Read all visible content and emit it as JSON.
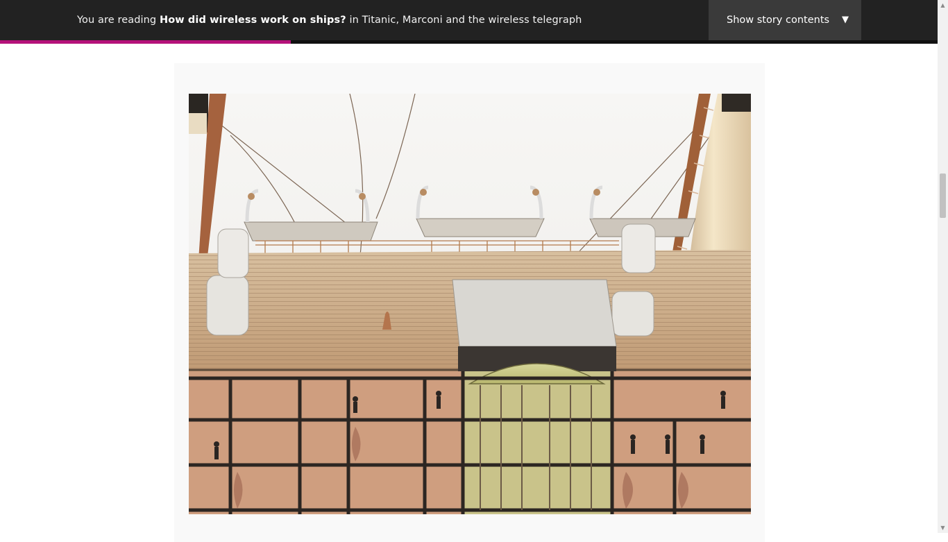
{
  "story_bar": {
    "prefix": "You are reading",
    "chapter_title": "How did wireless work on ships?",
    "connector": "in",
    "story_title": "Titanic, Marconi and the wireless telegraph",
    "contents_button_label": "Show story contents",
    "contents_button_icon": "triangle-down-icon",
    "reading_progress": 0.31,
    "accent_color": "#b5127a"
  },
  "scrollbar": {
    "up_icon": "scroll-up-arrow-icon",
    "down_icon": "scroll-down-arrow-icon"
  },
  "figure": {
    "image_subject": "ship-model-cutaway"
  }
}
